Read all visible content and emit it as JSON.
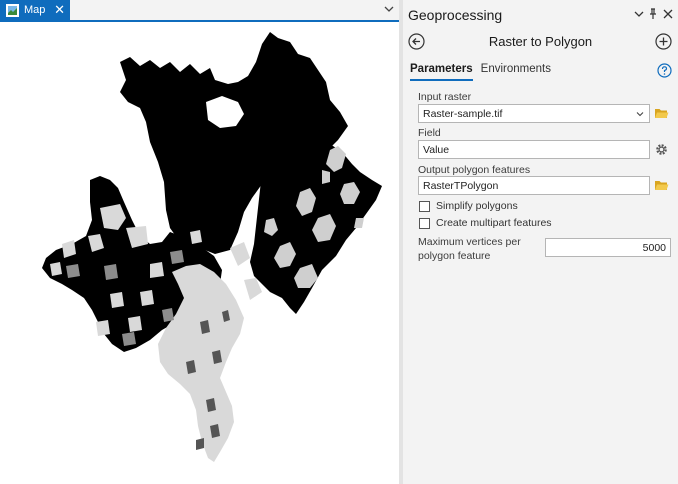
{
  "map_view": {
    "tab_label": "Map",
    "tab_close": "✕",
    "tab_icon": "map-document-icon",
    "menu_icon": "chevron-down-icon"
  },
  "geoprocessing": {
    "pane_title": "Geoprocessing",
    "pane_controls": [
      "pane-options-chevron-icon",
      "pin-icon",
      "close-icon"
    ],
    "tool_title": "Raster to Polygon",
    "back_icon": "back-arrow-icon",
    "add_icon": "add-icon",
    "help_icon": "help-icon",
    "tabs": [
      {
        "label": "Parameters",
        "active": true
      },
      {
        "label": "Environments",
        "active": false
      }
    ],
    "params": {
      "input_raster": {
        "label": "Input raster",
        "value": "Raster-sample.tif"
      },
      "field": {
        "label": "Field",
        "value": "Value"
      },
      "output": {
        "label": "Output polygon features",
        "value": "RasterTPolygon"
      },
      "simplify": {
        "label": "Simplify polygons",
        "checked": false
      },
      "multipart": {
        "label": "Create multipart features",
        "checked": false
      },
      "max_vertices": {
        "label": "Maximum vertices per polygon feature",
        "value": "5000"
      }
    }
  },
  "colors": {
    "accent": "#0f6cbd",
    "folder": "#d9a520",
    "pane_bg": "#f3f3f3",
    "raster_dark": "#000000",
    "raster_light": "#d6d6d6"
  }
}
